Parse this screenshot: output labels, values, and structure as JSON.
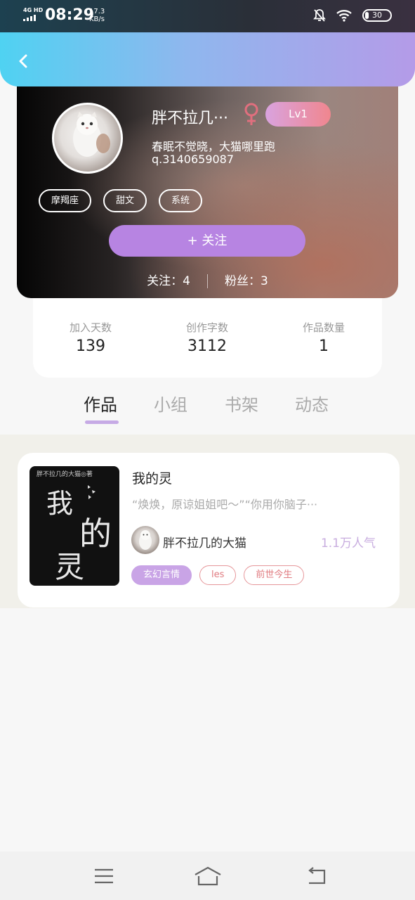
{
  "status_bar": {
    "network": "4G HD",
    "time": "08:29",
    "speed_value": "17.3",
    "speed_unit": "KB/s",
    "battery": "30"
  },
  "profile": {
    "name": "胖不拉几···",
    "level": "Lv1",
    "bio": "春眠不觉晓，大猫哪里跑",
    "qq": "q.3140659087",
    "tags": [
      "摩羯座",
      "甜文",
      "系统"
    ],
    "follow_button": "+  关注",
    "following_label": "关注：4",
    "fans_label": "粉丝：3"
  },
  "stats": [
    {
      "label": "加入天数",
      "value": "139"
    },
    {
      "label": "创作字数",
      "value": "3112"
    },
    {
      "label": "作品数量",
      "value": "1"
    }
  ],
  "tabs": [
    {
      "label": "作品",
      "active": true
    },
    {
      "label": "小组",
      "active": false
    },
    {
      "label": "书架",
      "active": false
    },
    {
      "label": "动态",
      "active": false
    }
  ],
  "works": [
    {
      "title": "我的灵",
      "excerpt": "“焕焕，原谅姐姐吧～”“你用你脑子···",
      "cover": {
        "byline": "胖不拉几的大猫◎著",
        "chars": [
          "我",
          "的",
          "灵"
        ]
      },
      "author": "胖不拉几的大猫",
      "popularity": "1.1万人气",
      "tags": [
        "玄幻言情",
        "les",
        "前世今生"
      ]
    }
  ],
  "colors": {
    "header_gradient_start": "#4fd2f2",
    "header_gradient_end": "#b49be8",
    "accent_purple": "#b784e2",
    "tag_pink": "#e07b80"
  },
  "icons": {
    "back": "chevron-left",
    "mute": "bell-slash",
    "wifi": "wifi",
    "gender": "female",
    "nav_menu": "hamburger",
    "nav_home": "home",
    "nav_back": "return"
  }
}
